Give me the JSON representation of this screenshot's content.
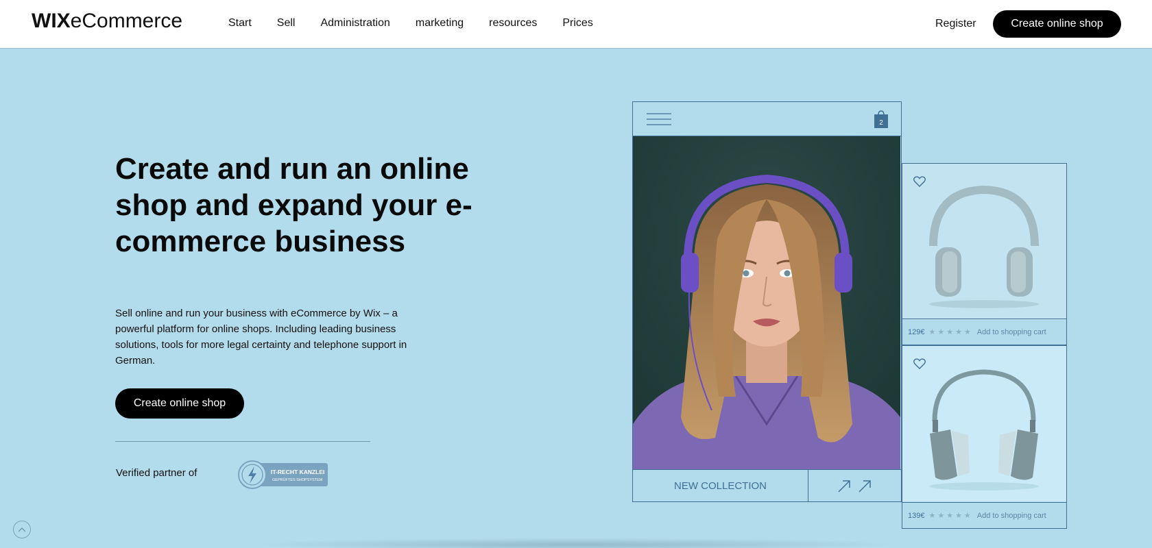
{
  "header": {
    "logo_bold": "WIX",
    "logo_rest": "eCommerce",
    "nav": [
      "Start",
      "Sell",
      "Administration",
      "marketing",
      "resources",
      "Prices"
    ],
    "register": "Register",
    "cta": "Create online shop"
  },
  "hero": {
    "title": "Create and run an online shop and expand your e-commerce business",
    "description": "Sell online and run your business with eCommerce by Wix – a powerful platform for online shops. Including leading business solutions, tools for more legal certainty and telephone support in German.",
    "cta": "Create online shop",
    "verified_label": "Verified partner of",
    "badge_line1": "IT-RECHT KANZLEI",
    "badge_line2": "GEPRÜFTES SHOPSYSTEM"
  },
  "mockup": {
    "cart_count": "2",
    "collection_label": "NEW COLLECTION",
    "stars": "★★★★★",
    "products": [
      {
        "price": "129€",
        "add_label": "Add to shopping cart"
      },
      {
        "price": "139€",
        "add_label": "Add to shopping cart"
      }
    ]
  },
  "colors": {
    "background": "#b2dbeb",
    "accent": "#3f6f95",
    "button": "#000000"
  }
}
